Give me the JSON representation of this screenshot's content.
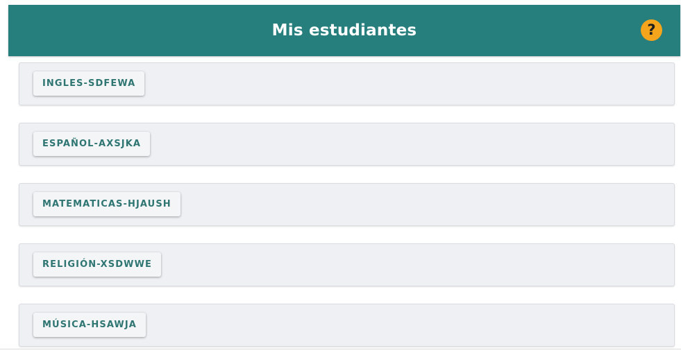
{
  "header": {
    "title": "Mis estudiantes",
    "help_icon": "question-mark-icon",
    "help_symbol": "?",
    "background_color": "#267f7d",
    "help_color": "#f4a51c"
  },
  "courses": [
    {
      "label": "INGLES-SDFEWA"
    },
    {
      "label": "ESPAÑOL-AXSJKA"
    },
    {
      "label": "MATEMATICAS-HJAUSH"
    },
    {
      "label": "RELIGIÓN-XSDWWE"
    },
    {
      "label": "MÚSICA-HSAWJA"
    }
  ],
  "colors": {
    "accent_text": "#2f7673",
    "card_background": "#eef0f3"
  }
}
